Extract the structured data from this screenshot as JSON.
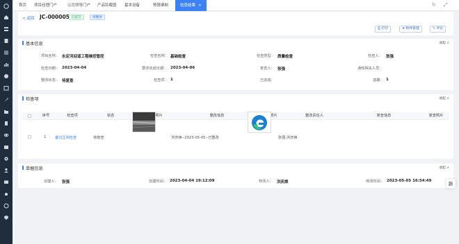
{
  "tabs": [
    {
      "label": "首页"
    },
    {
      "label": "项目经理门户"
    },
    {
      "label": "公司领导门户"
    },
    {
      "label": "产品铃载图"
    },
    {
      "label": "基本设备"
    },
    {
      "label": "预算编制"
    },
    {
      "label": "检查结果",
      "close": "×"
    }
  ],
  "top_tools": {
    "refresh": "↻",
    "maximize": "⤢"
  },
  "header": {
    "back_label": "< 返回",
    "doc_no": "JC-000005",
    "status_badge": "已提交",
    "stage_badge": "待整改",
    "actions": {
      "print": "打印",
      "attachments": "附件管理",
      "comment": "评论"
    }
  },
  "basic_info": {
    "title": "基本信息",
    "collapse": "收起 ∧",
    "fields": {
      "project_name_label": "项目名称：",
      "project_name": "永定河迎道工程维控管控",
      "check_name_label": "检查名称：",
      "check_name": "基础检查",
      "check_type_label": "检查类型：",
      "check_type": "质量检查",
      "inspector_label": "检查人：",
      "inspector": "张强",
      "check_date_label": "检查日期：",
      "check_date": "2023-04-04",
      "rectify_deadline_label": "要求完成日期：",
      "rectify_deadline": "2023-04-06",
      "reviewer_label": "复查人：",
      "reviewer": "张强",
      "notify_label": "通知相关人员：",
      "notify": "",
      "rectify_status_label": "整改状态：",
      "rectify_status": "待复查",
      "check_items_label": "检查项：",
      "check_items": "1",
      "closed_label": "已完成：",
      "closed": "",
      "overdue_label": "逾期：",
      "overdue": "1"
    }
  },
  "check_items": {
    "title": "检查项",
    "collapse": "收起 ∧",
    "columns": {
      "no": "序号",
      "item": "检查项",
      "status": "状态",
      "problem_photo": "问题照片",
      "rectify_content": "整改信息",
      "rectify_photo": "整改照片",
      "rectify_person": "整改责任人",
      "review_info": "复查信息",
      "review_photo": "复查照片"
    },
    "star": "*",
    "rows": [
      {
        "no": "1",
        "item": "基坑压实检查",
        "status": "待复查",
        "rectify_content": "洪庆焕--2023-05-05--已整改",
        "rectify_person": "张强,洪庆焕"
      }
    ]
  },
  "doc_info": {
    "title": "单据信息",
    "collapse": "收起 ∧",
    "creator_label": "创建人：",
    "creator": "张强",
    "created_time_label": "创建时间：",
    "created_time": "2023-04-04 19:12:09",
    "modifier_label": "修改人：",
    "modifier": "洪庆焕",
    "modified_time_label": "修改时间：",
    "modified_time": "2023-05-05 16:54:49"
  },
  "colors": {
    "accent": "#3b82f6",
    "sidebar": "#1f2d3d"
  }
}
